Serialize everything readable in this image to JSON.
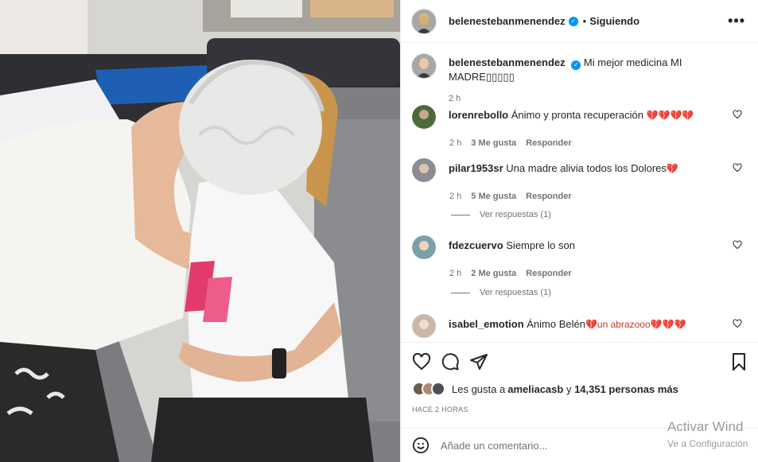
{
  "post": {
    "username": "belenestebanmenendez",
    "separator": "•",
    "follow_status": "Siguiendo",
    "more_label": "•••",
    "caption": "Mi mejor medicina MI MADRE▯▯▯▯▯",
    "caption_time": "2 h"
  },
  "comments": [
    {
      "user": "lorenrebollo",
      "text": "Ánimo y pronta recuperación ",
      "hearts": "💔💔💔💔",
      "time": "2 h",
      "likes": "3 Me gusta",
      "reply": "Responder",
      "avatar_color": "#4a6b3a"
    },
    {
      "user": "pilar1953sr",
      "text": "Una madre alivia todos los Dolores",
      "hearts": "💔",
      "time": "2 h",
      "likes": "5 Me gusta",
      "reply": "Responder",
      "view_replies": "Ver respuestas (1)",
      "avatar_color": "#8a8d94"
    },
    {
      "user": "fdezcuervo",
      "text": "Siempre lo son",
      "hearts": "",
      "time": "2 h",
      "likes": "2 Me gusta",
      "reply": "Responder",
      "view_replies": "Ver respuestas (1)",
      "avatar_color": "#7ba1a6"
    },
    {
      "user": "isabel_emotion",
      "text": "Ánimo Belén",
      "hearts": "💔un abrazooo💔💔💔",
      "avatar_color": "#c9b7a9"
    }
  ],
  "likes": {
    "prefix": "Les gusta a ",
    "user": "ameliacasb",
    "middle": " y ",
    "count": "14,351 personas más"
  },
  "time_ago": "HACE 2 HORAS",
  "add_comment": {
    "placeholder": "Añade un comentario..."
  },
  "watermark": {
    "line1": "Activar Wind",
    "line2": "Ve a Configuración"
  },
  "colors": {
    "verified": "#0095f6",
    "muted": "#737373",
    "text": "#262626",
    "border": "#efefef"
  },
  "icons": [
    "heart-icon",
    "comment-icon",
    "share-icon",
    "bookmark-icon",
    "emoji-icon",
    "more-options-icon",
    "verified-badge-icon"
  ]
}
